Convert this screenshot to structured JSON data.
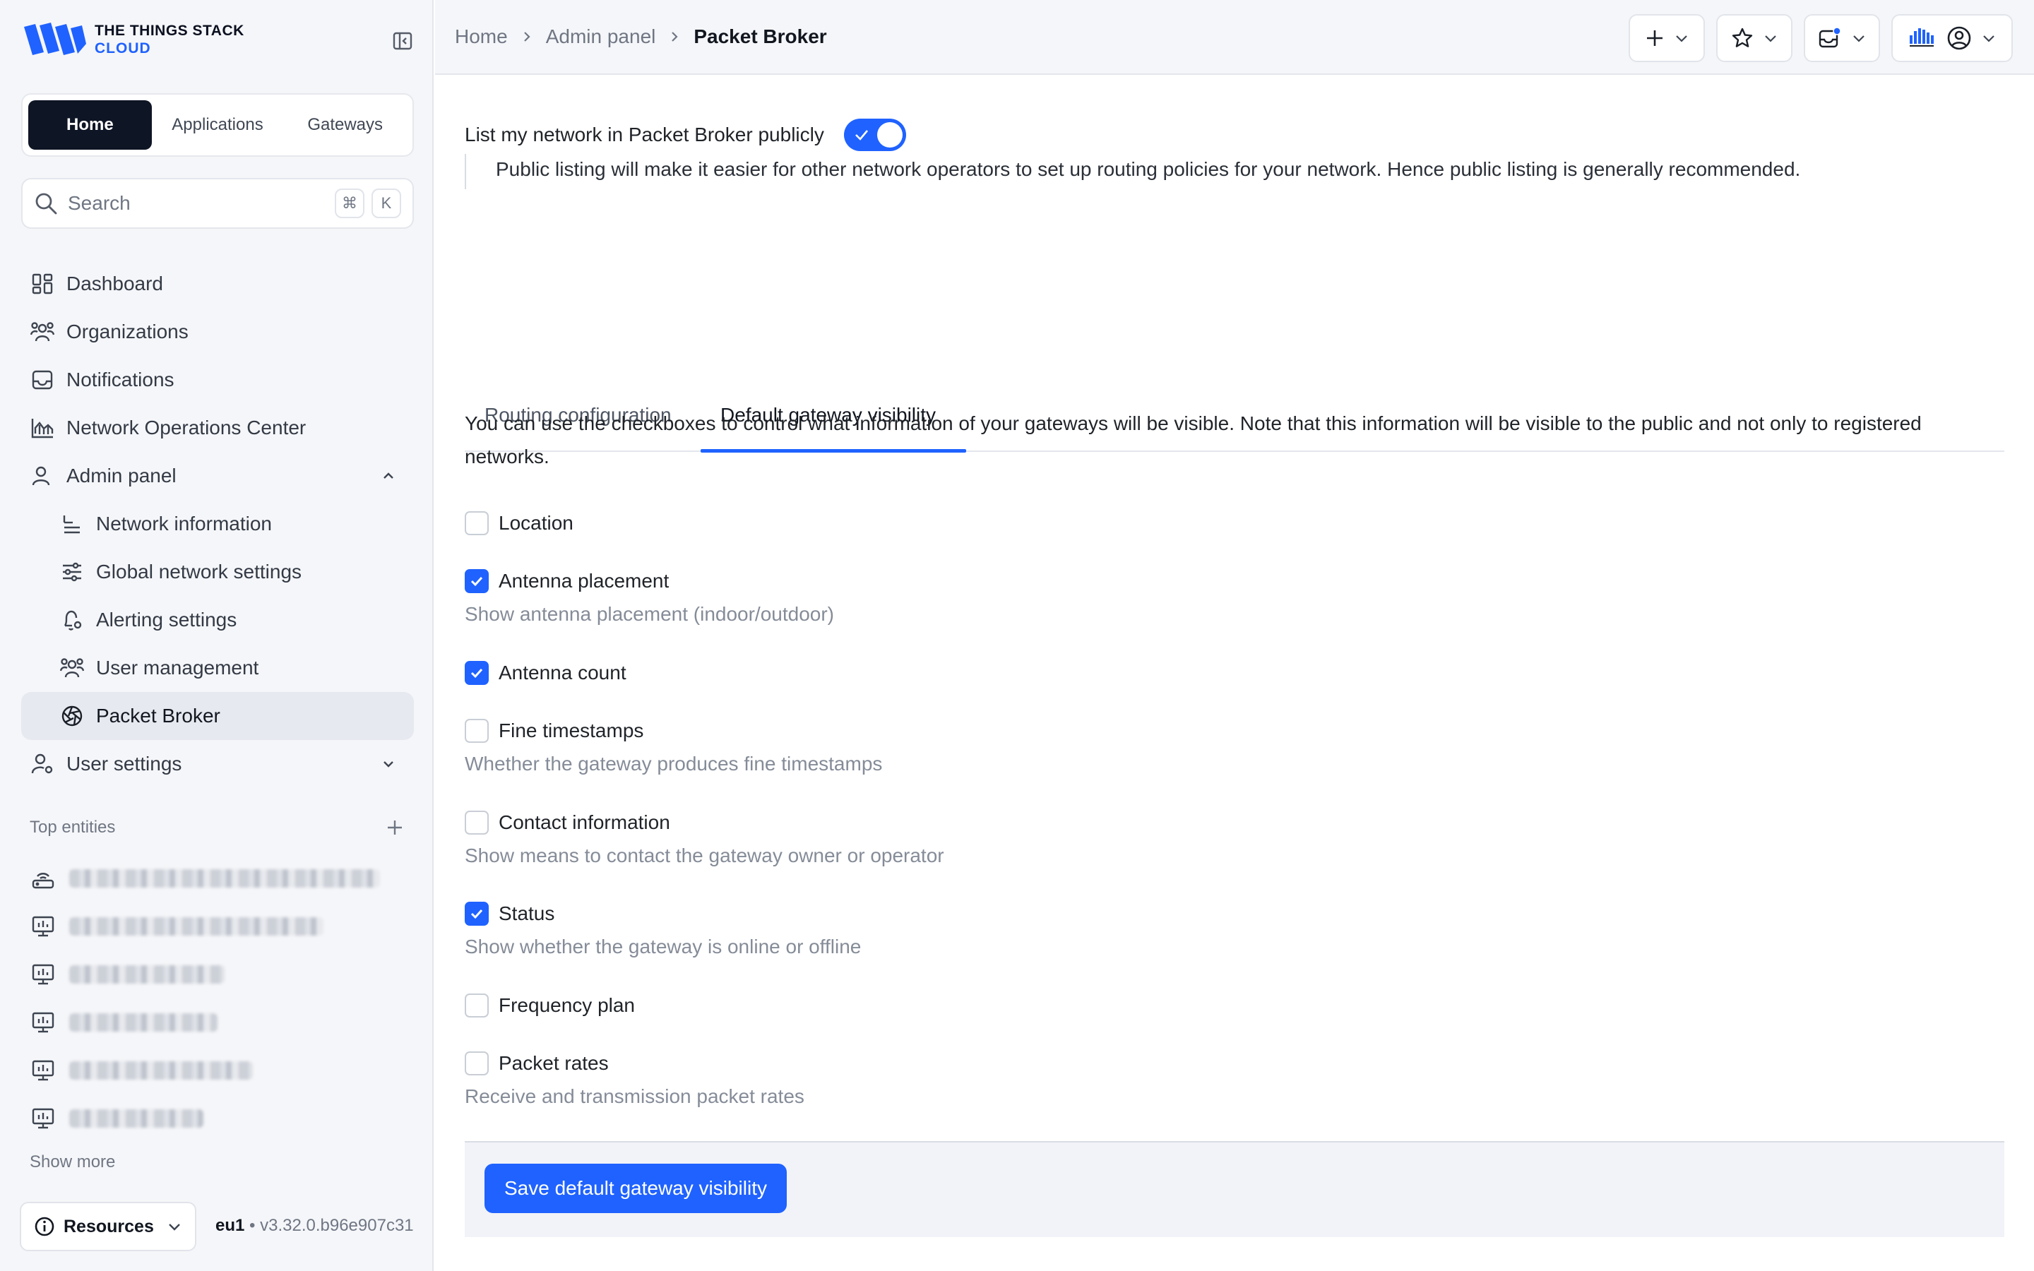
{
  "brand": {
    "line1": "THE THINGS STACK",
    "line2": "CLOUD"
  },
  "colors": {
    "accent": "#1f62ff",
    "dark": "#0e1525"
  },
  "switcher": [
    "Home",
    "Applications",
    "Gateways"
  ],
  "search": {
    "placeholder": "Search",
    "kbd1": "⌘",
    "kbd2": "K"
  },
  "nav": {
    "dashboard": "Dashboard",
    "organizations": "Organizations",
    "notifications": "Notifications",
    "noc": "Network Operations Center",
    "admin_panel": "Admin panel",
    "network_information": "Network information",
    "global_network_settings": "Global network settings",
    "alerting_settings": "Alerting settings",
    "user_management": "User management",
    "packet_broker": "Packet Broker",
    "user_settings": "User settings"
  },
  "top_entities": {
    "title": "Top entities",
    "show_more": "Show more"
  },
  "resources_label": "Resources",
  "version": {
    "cluster": "eu1",
    "sep": " • ",
    "build": "v3.32.0.b96e907c31"
  },
  "breadcrumb": [
    "Home",
    "Admin panel",
    "Packet Broker"
  ],
  "listing": {
    "label": "List my network in Packet Broker publicly",
    "enabled": true,
    "hint": "Public listing will make it easier for other network operators to set up routing policies for your network. Hence public listing is generally recommended."
  },
  "tabs": [
    "Routing configuration",
    "Default gateway visibility"
  ],
  "visibility": {
    "description": "You can use the checkboxes to control what information of your gateways will be visible. Note that this information will be visible to the public and not only to registered networks.",
    "options": [
      {
        "label": "Location",
        "checked": false,
        "description": ""
      },
      {
        "label": "Antenna placement",
        "checked": true,
        "description": "Show antenna placement (indoor/outdoor)"
      },
      {
        "label": "Antenna count",
        "checked": true,
        "description": ""
      },
      {
        "label": "Fine timestamps",
        "checked": false,
        "description": "Whether the gateway produces fine timestamps"
      },
      {
        "label": "Contact information",
        "checked": false,
        "description": "Show means to contact the gateway owner or operator"
      },
      {
        "label": "Status",
        "checked": true,
        "description": "Show whether the gateway is online or offline"
      },
      {
        "label": "Frequency plan",
        "checked": false,
        "description": ""
      },
      {
        "label": "Packet rates",
        "checked": false,
        "description": "Receive and transmission packet rates"
      }
    ],
    "save_label": "Save default gateway visibility"
  }
}
